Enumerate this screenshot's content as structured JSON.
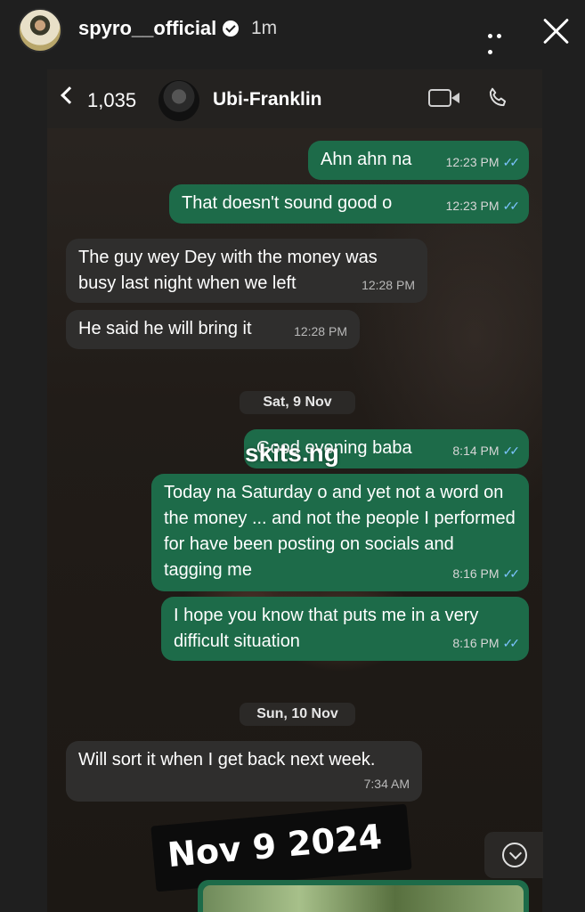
{
  "story": {
    "username": "spyro__official",
    "time_ago": "1m",
    "verified": true
  },
  "chat": {
    "unread_count": "1,035",
    "contact_name": "Ubi-Franklin",
    "colors": {
      "outgoing": "#1d6b49",
      "incoming": "#2f2e2d",
      "read_ticks": "#7cc3ff"
    },
    "messages": [
      {
        "dir": "out",
        "text": "Ahn ahn na",
        "time": "12:23 PM",
        "ticks": "✓✓"
      },
      {
        "dir": "out",
        "text": "That doesn't sound good o",
        "time": "12:23 PM",
        "ticks": "✓✓"
      },
      {
        "dir": "in",
        "text": "The guy wey Dey with the money was busy last night when we left",
        "time": "12:28 PM"
      },
      {
        "dir": "in",
        "text": "He said he will bring it",
        "time": "12:28 PM"
      },
      {
        "dir": "out",
        "text": "Good evening baba",
        "time": "8:14 PM",
        "ticks": "✓✓"
      },
      {
        "dir": "out",
        "text": "Today na Saturday o and yet not a word on the money ... and not the people I performed for have been posting on socials and tagging me",
        "time": "8:16 PM",
        "ticks": "✓✓"
      },
      {
        "dir": "out",
        "text": "I hope you know that puts me in a very difficult situation",
        "time": "8:16 PM",
        "ticks": "✓✓"
      },
      {
        "dir": "in",
        "text": "Will sort it when I get back next week.",
        "time": "7:34 AM"
      }
    ],
    "date_separators": [
      "Sat, 9 Nov",
      "Sun, 10 Nov"
    ]
  },
  "overlays": {
    "watermark": "skits.ng",
    "date_sticker": "Nov 9 2024"
  },
  "icons": [
    "back-chevron-icon",
    "video-call-icon",
    "phone-icon",
    "more-icon",
    "close-icon",
    "verified-badge-icon",
    "scroll-down-icon"
  ]
}
